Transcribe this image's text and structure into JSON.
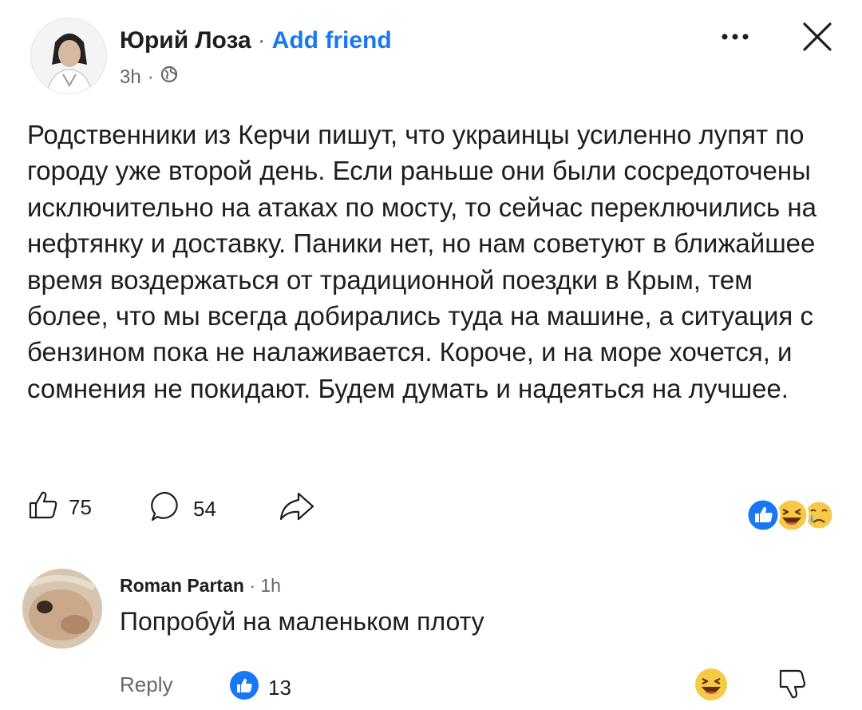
{
  "post": {
    "author": "Юрий Лоза",
    "separator": "·",
    "add_friend": "Add friend",
    "time": "3h",
    "time_separator": "·",
    "privacy_icon": "globe-icon",
    "text": "Родственники из Керчи пишут, что украинцы усиленно лупят по городу уже второй день. Если раньше они были сосредоточены исключительно на атаках по мосту, то сейчас переключились на нефтянку и доставку. Паники нет, но нам советуют в ближайшее время воздержаться от традиционной поездки в Крым, тем более, что мы всегда добирались туда на машине, а ситуация с бензином пока не налаживается. Короче, и на море хочется, и сомнения не покидают. Будем думать и надеяться на лучшее.",
    "likes": "75",
    "comments": "54",
    "reactions": [
      "like-icon",
      "laugh-icon",
      "sad-icon"
    ]
  },
  "comment": {
    "author": "Roman Partan",
    "separator": "·",
    "time": "1h",
    "text": "Попробуй на маленьком плоту",
    "reply_label": "Reply",
    "likes": "13"
  },
  "colors": {
    "accent": "#1877f2",
    "secondary_text": "#65676b",
    "reaction_yellow": "#f7c948"
  }
}
